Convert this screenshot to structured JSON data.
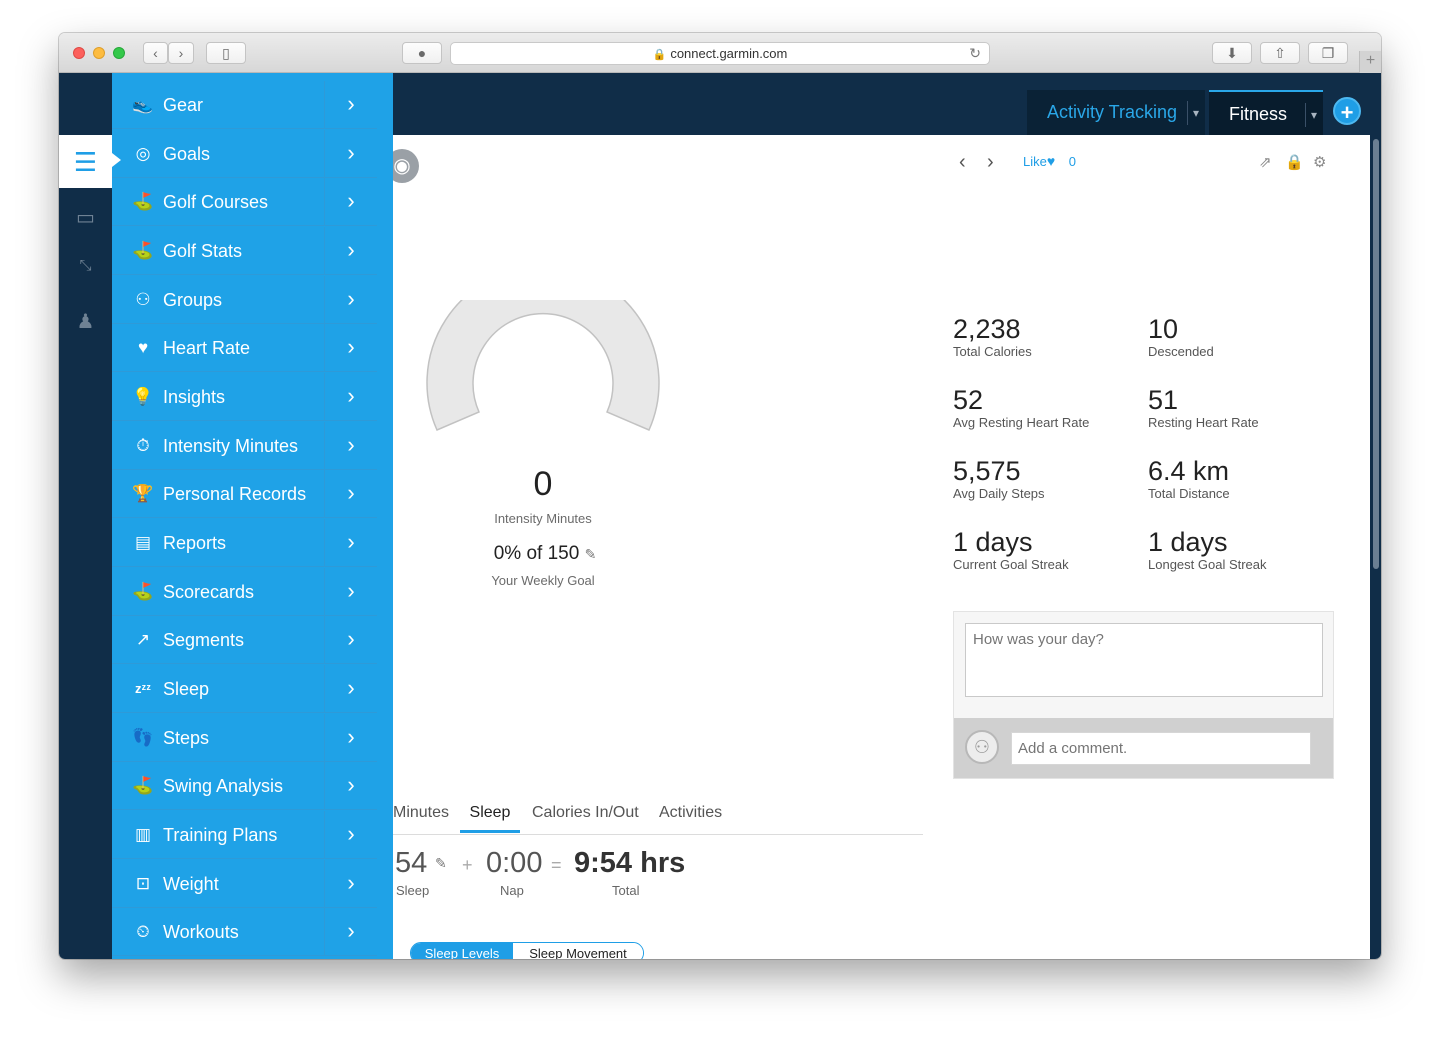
{
  "browser": {
    "url": "connect.garmin.com"
  },
  "topnav": {
    "tabs": [
      {
        "label": "Activity Tracking"
      },
      {
        "label": "Fitness"
      }
    ],
    "add_label": "+"
  },
  "menu": {
    "items": [
      {
        "label": "Gear",
        "icon": "shoe-icon"
      },
      {
        "label": "Goals",
        "icon": "target-icon"
      },
      {
        "label": "Golf Courses",
        "icon": "golfer-icon"
      },
      {
        "label": "Golf Stats",
        "icon": "golfer-icon"
      },
      {
        "label": "Groups",
        "icon": "group-icon"
      },
      {
        "label": "Heart Rate",
        "icon": "heart-icon"
      },
      {
        "label": "Insights",
        "icon": "lightbulb-icon"
      },
      {
        "label": "Intensity Minutes",
        "icon": "stopwatch-icon"
      },
      {
        "label": "Personal Records",
        "icon": "trophy-icon"
      },
      {
        "label": "Reports",
        "icon": "chart-icon"
      },
      {
        "label": "Scorecards",
        "icon": "golfer-icon"
      },
      {
        "label": "Segments",
        "icon": "segment-icon"
      },
      {
        "label": "Sleep",
        "icon": "zzz-icon"
      },
      {
        "label": "Steps",
        "icon": "footprints-icon"
      },
      {
        "label": "Swing Analysis",
        "icon": "golfer-icon"
      },
      {
        "label": "Training Plans",
        "icon": "notebook-icon"
      },
      {
        "label": "Weight",
        "icon": "scale-icon"
      },
      {
        "label": "Workouts",
        "icon": "timer-icon"
      }
    ]
  },
  "header": {
    "like_label": "Like",
    "like_count": "0"
  },
  "gauge": {
    "value": "0",
    "caption": "Intensity Minutes",
    "goal_text": "0% of 150",
    "goal_caption": "Your Weekly Goal",
    "progress": 0
  },
  "stats": [
    {
      "value": "2,238",
      "label": "Total Calories"
    },
    {
      "value": "10",
      "label": "Descended"
    },
    {
      "value": "52",
      "label": "Avg Resting Heart Rate"
    },
    {
      "value": "51",
      "label": "Resting Heart Rate"
    },
    {
      "value": "5,575",
      "label": "Avg Daily Steps"
    },
    {
      "value": "6.4 km",
      "label": "Total Distance"
    },
    {
      "value": "1 days",
      "label": "Current Goal Streak"
    },
    {
      "value": "1 days",
      "label": "Longest Goal Streak"
    }
  ],
  "comments": {
    "day_placeholder": "How was your day?",
    "comment_placeholder": "Add a comment."
  },
  "tabs": [
    {
      "label": "Minutes"
    },
    {
      "label": "Sleep"
    },
    {
      "label": "Calories In/Out"
    },
    {
      "label": "Activities"
    }
  ],
  "sleep": {
    "sleep_value": "54",
    "sleep_label": "Sleep",
    "plus": "+",
    "nap_value": "0:00",
    "nap_label": "Nap",
    "equals": "=",
    "total_value": "9:54 hrs",
    "total_label": "Total",
    "toggle_on": "Sleep Levels",
    "toggle_off": "Sleep Movement"
  },
  "colors": {
    "accent": "#1f9ee6",
    "nav": "#102d48",
    "drawer": "#1fa2e7"
  }
}
